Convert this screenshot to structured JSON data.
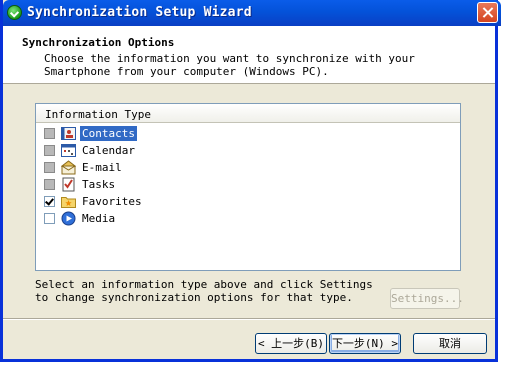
{
  "window": {
    "title": "Synchronization Setup Wizard"
  },
  "header": {
    "title": "Synchronization Options",
    "description": "Choose the information you want to synchronize with your Smartphone from your computer (Windows PC)."
  },
  "list": {
    "column_header": "Information Type",
    "items": [
      {
        "label": "Contacts",
        "checked": false,
        "disabled": true,
        "selected": true,
        "icon": "contacts-icon"
      },
      {
        "label": "Calendar",
        "checked": false,
        "disabled": true,
        "selected": false,
        "icon": "calendar-icon"
      },
      {
        "label": "E-mail",
        "checked": false,
        "disabled": true,
        "selected": false,
        "icon": "email-icon"
      },
      {
        "label": "Tasks",
        "checked": false,
        "disabled": true,
        "selected": false,
        "icon": "tasks-icon"
      },
      {
        "label": "Favorites",
        "checked": true,
        "disabled": false,
        "selected": false,
        "icon": "favorites-folder-icon"
      },
      {
        "label": "Media",
        "checked": false,
        "disabled": false,
        "selected": false,
        "icon": "media-icon"
      }
    ]
  },
  "footer": {
    "instruction": "Select an information type above and click Settings to change synchronization options for that type.",
    "settings_label": "Settings..."
  },
  "buttons": {
    "back_label": "< 上一步(B)",
    "next_label": "下一步(N) >",
    "cancel_label": "取消"
  },
  "colors": {
    "titlebar": "#0452d9",
    "selection": "#316ac5",
    "dialog_bg": "#ece9d8"
  }
}
